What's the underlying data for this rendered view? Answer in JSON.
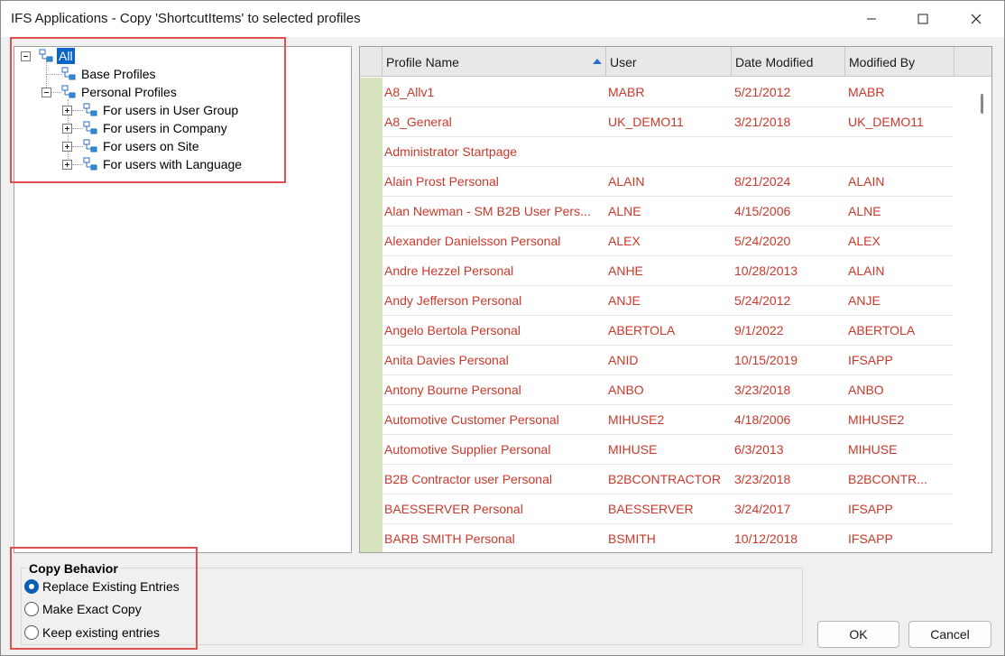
{
  "window": {
    "title": "IFS Applications - Copy 'ShortcutItems' to selected profiles"
  },
  "tree": {
    "root": "All",
    "base": "Base Profiles",
    "personal": "Personal Profiles",
    "children": [
      "For users in User Group",
      "For users in Company",
      "For users on Site",
      "For users with Language"
    ]
  },
  "grid": {
    "columns": [
      "Profile Name",
      "User",
      "Date Modified",
      "Modified By"
    ],
    "sort_column": "Profile Name",
    "rows": [
      [
        "A8_Allv1",
        "MABR",
        "5/21/2012",
        "MABR"
      ],
      [
        "A8_General",
        "UK_DEMO11",
        "3/21/2018",
        "UK_DEMO11"
      ],
      [
        "Administrator Startpage",
        "",
        "",
        ""
      ],
      [
        "Alain Prost Personal",
        "ALAIN",
        "8/21/2024",
        "ALAIN"
      ],
      [
        "Alan Newman - SM B2B User Pers...",
        "ALNE",
        "4/15/2006",
        "ALNE"
      ],
      [
        "Alexander Danielsson Personal",
        "ALEX",
        "5/24/2020",
        "ALEX"
      ],
      [
        "Andre Hezzel Personal",
        "ANHE",
        "10/28/2013",
        "ALAIN"
      ],
      [
        "Andy Jefferson Personal",
        "ANJE",
        "5/24/2012",
        "ANJE"
      ],
      [
        "Angelo Bertola Personal",
        "ABERTOLA",
        "9/1/2022",
        "ABERTOLA"
      ],
      [
        "Anita Davies Personal",
        "ANID",
        "10/15/2019",
        "IFSAPP"
      ],
      [
        "Antony Bourne Personal",
        "ANBO",
        "3/23/2018",
        "ANBO"
      ],
      [
        "Automotive Customer Personal",
        "MIHUSE2",
        "4/18/2006",
        "MIHUSE2"
      ],
      [
        "Automotive Supplier Personal",
        "MIHUSE",
        "6/3/2013",
        "MIHUSE"
      ],
      [
        "B2B Contractor user Personal",
        "B2BCONTRACTOR",
        "3/23/2018",
        "B2BCONTR..."
      ],
      [
        "BAESSERVER Personal",
        "BAESSERVER",
        "3/24/2017",
        "IFSAPP"
      ],
      [
        "BARB SMITH Personal",
        "BSMITH",
        "10/12/2018",
        "IFSAPP"
      ]
    ]
  },
  "copy_behavior": {
    "title": "Copy Behavior",
    "options": [
      "Replace Existing Entries",
      "Make Exact Copy",
      "Keep existing entries"
    ],
    "selected": "Replace Existing Entries"
  },
  "buttons": {
    "ok": "OK",
    "cancel": "Cancel"
  },
  "colors": {
    "row_text": "#c8392b",
    "selection": "#0a64c8",
    "gutter": "#d7e4bd",
    "annotation": "#e05050"
  }
}
